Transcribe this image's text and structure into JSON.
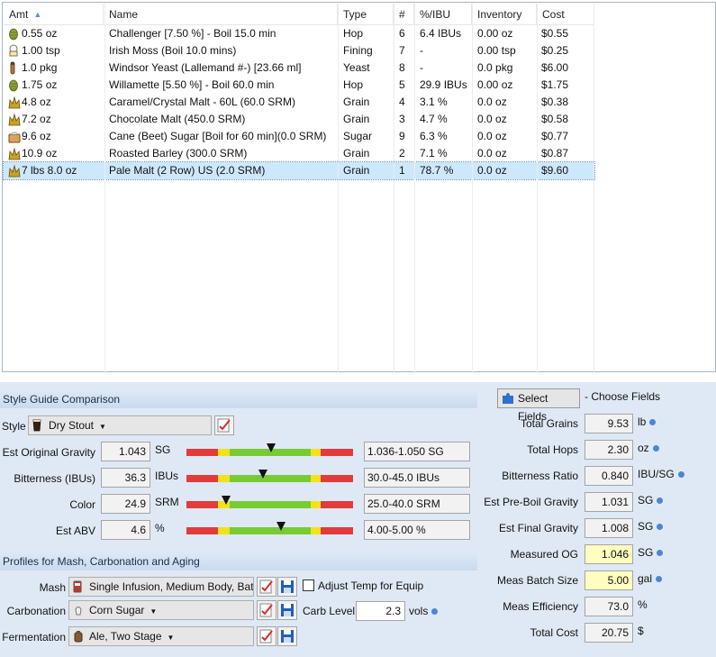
{
  "grid": {
    "columns": [
      {
        "label": "Amt"
      },
      {
        "label": "Name"
      },
      {
        "label": "Type"
      },
      {
        "label": "#"
      },
      {
        "label": "%/IBU"
      },
      {
        "label": "Inventory"
      },
      {
        "label": "Cost"
      }
    ],
    "rows": [
      {
        "icon": "hop-icon",
        "amt": "0.55 oz",
        "name": "Challenger [7.50 %] - Boil 15.0 min",
        "type": "Hop",
        "num": "6",
        "pct": "6.4 IBUs",
        "inv": "0.00 oz",
        "cost": "$0.55"
      },
      {
        "icon": "fining-icon",
        "amt": "1.00 tsp",
        "name": "Irish Moss (Boil 10.0 mins)",
        "type": "Fining",
        "num": "7",
        "pct": "-",
        "inv": "0.00 tsp",
        "cost": "$0.25"
      },
      {
        "icon": "yeast-vial-icon",
        "amt": "1.0 pkg",
        "name": "Windsor Yeast (Lallemand #-) [23.66 ml]",
        "type": "Yeast",
        "num": "8",
        "pct": "-",
        "inv": "0.0 pkg",
        "cost": "$6.00"
      },
      {
        "icon": "hop-icon",
        "amt": "1.75 oz",
        "name": "Willamette [5.50 %] - Boil 60.0 min",
        "type": "Hop",
        "num": "5",
        "pct": "29.9 IBUs",
        "inv": "0.00 oz",
        "cost": "$1.75"
      },
      {
        "icon": "grain-icon",
        "amt": "4.8 oz",
        "name": "Caramel/Crystal Malt - 60L (60.0 SRM)",
        "type": "Grain",
        "num": "4",
        "pct": "3.1 %",
        "inv": "0.0 oz",
        "cost": "$0.38"
      },
      {
        "icon": "grain-icon",
        "amt": "7.2 oz",
        "name": "Chocolate Malt (450.0 SRM)",
        "type": "Grain",
        "num": "3",
        "pct": "4.7 %",
        "inv": "0.0 oz",
        "cost": "$0.58"
      },
      {
        "icon": "sugar-icon",
        "amt": "9.6 oz",
        "name": "Cane (Beet) Sugar [Boil for 60 min](0.0 SRM)",
        "type": "Sugar",
        "num": "9",
        "pct": "6.3 %",
        "inv": "0.0 oz",
        "cost": "$0.77"
      },
      {
        "icon": "grain-icon",
        "amt": "10.9 oz",
        "name": "Roasted Barley (300.0 SRM)",
        "type": "Grain",
        "num": "2",
        "pct": "7.1 %",
        "inv": "0.0 oz",
        "cost": "$0.87"
      },
      {
        "icon": "grain-icon",
        "amt": "7 lbs 8.0 oz",
        "name": "Pale Malt (2 Row) US (2.0 SRM)",
        "type": "Grain",
        "num": "1",
        "pct": "78.7 %",
        "inv": "0.0 oz",
        "cost": "$9.60"
      }
    ]
  },
  "style_section": {
    "title": "Style Guide Comparison",
    "style_label": "Style",
    "style_value": "Dry Stout",
    "gauges": [
      {
        "label": "Est Original Gravity",
        "value": "1.043",
        "unit": "SG",
        "range": "1.036-1.050 SG",
        "level": 0.51
      },
      {
        "label": "Bitterness (IBUs)",
        "value": "36.3",
        "unit": "IBUs",
        "range": "30.0-45.0 IBUs",
        "level": 0.46
      },
      {
        "label": "Color",
        "value": "24.9",
        "unit": "SRM",
        "range": "25.0-40.0 SRM",
        "level": 0.24
      },
      {
        "label": "Est ABV",
        "value": "4.6",
        "unit": "%",
        "range": "4.00-5.00 %",
        "level": 0.57
      }
    ]
  },
  "profiles_section": {
    "title": "Profiles for Mash, Carbonation and Aging",
    "mash_label": "Mash",
    "mash_value": "Single Infusion, Medium Body, Batch Sparge",
    "adjust_label": "Adjust Temp for Equip",
    "carbonation_label": "Carbonation",
    "carbonation_value": "Corn Sugar",
    "carb_level_label": "Carb Level",
    "carb_level_value": "2.3",
    "carb_level_unit": "vols",
    "fermentation_label": "Fermentation",
    "fermentation_value": "Ale, Two Stage"
  },
  "fields": {
    "select_button": "Select Fields",
    "choose_label": "- Choose Fields",
    "items": [
      {
        "label": "Total Grains",
        "value": "9.53",
        "unit": "lb",
        "dot": true,
        "highlight": false
      },
      {
        "label": "Total Hops",
        "value": "2.30",
        "unit": "oz",
        "dot": true,
        "highlight": false
      },
      {
        "label": "Bitterness Ratio",
        "value": "0.840",
        "unit": "IBU/SG",
        "dot": true,
        "highlight": false
      },
      {
        "label": "Est Pre-Boil Gravity",
        "value": "1.031",
        "unit": "SG",
        "dot": true,
        "highlight": false
      },
      {
        "label": "Est Final Gravity",
        "value": "1.008",
        "unit": "SG",
        "dot": true,
        "highlight": false
      },
      {
        "label": "Measured OG",
        "value": "1.046",
        "unit": "SG",
        "dot": true,
        "highlight": true
      },
      {
        "label": "Meas Batch Size",
        "value": "5.00",
        "unit": "gal",
        "dot": true,
        "highlight": true
      },
      {
        "label": "Meas Efficiency",
        "value": "73.0",
        "unit": "%",
        "dot": false,
        "highlight": false
      },
      {
        "label": "Total Cost",
        "value": "20.75",
        "unit": "$",
        "dot": false,
        "highlight": false
      }
    ]
  },
  "colors": {
    "selected_row": "#cde8fb",
    "panel": "#dfe9f5",
    "highlight_field": "#fffdbf",
    "gauge_red": "#e23b3b",
    "gauge_yellow": "#f2e21b",
    "gauge_green": "#77cc33"
  }
}
